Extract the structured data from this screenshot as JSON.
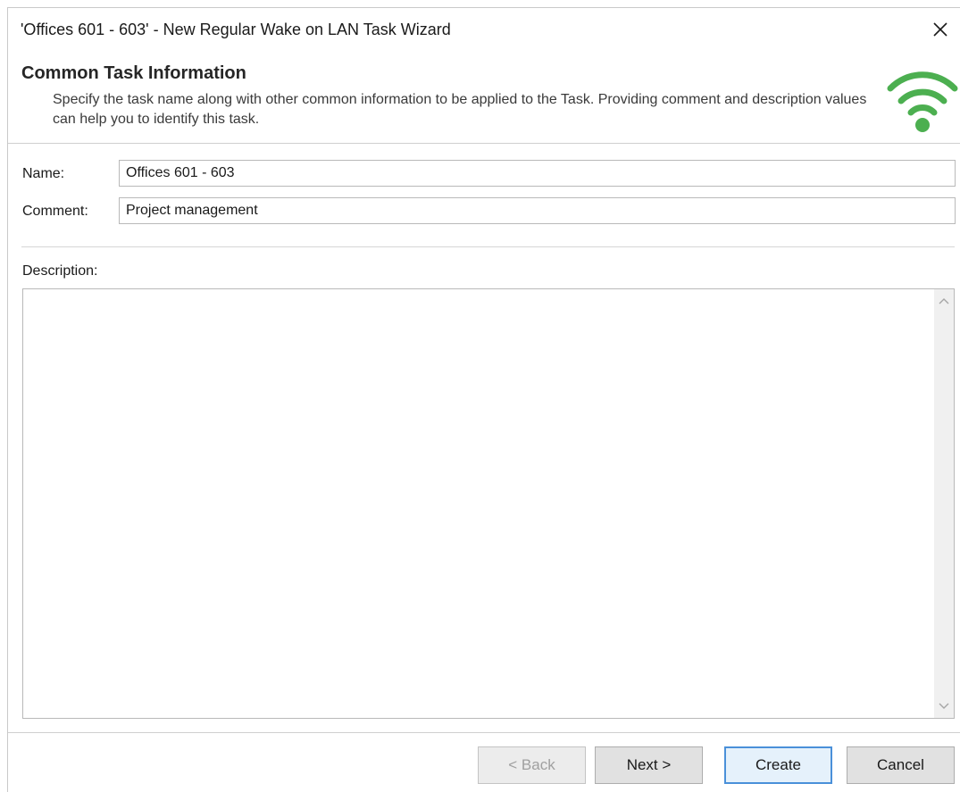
{
  "window": {
    "title": "'Offices 601 - 603' - New Regular Wake on LAN Task Wizard",
    "close_icon": "close-icon"
  },
  "header": {
    "title": "Common Task Information",
    "description": "Specify the task name along with other common information to be applied to the Task. Providing comment and description values can help you to identify this task.",
    "icon": "wifi-icon",
    "icon_color": "#4caf50"
  },
  "form": {
    "name_label": "Name:",
    "name_value": "Offices 601 - 603",
    "comment_label": "Comment:",
    "comment_value": "Project management",
    "description_label": "Description:",
    "description_value": ""
  },
  "buttons": {
    "back": "< Back",
    "next": "Next >",
    "create": "Create",
    "cancel": "Cancel"
  },
  "colors": {
    "accent": "#4a90d9",
    "wifi_green": "#4caf50"
  }
}
